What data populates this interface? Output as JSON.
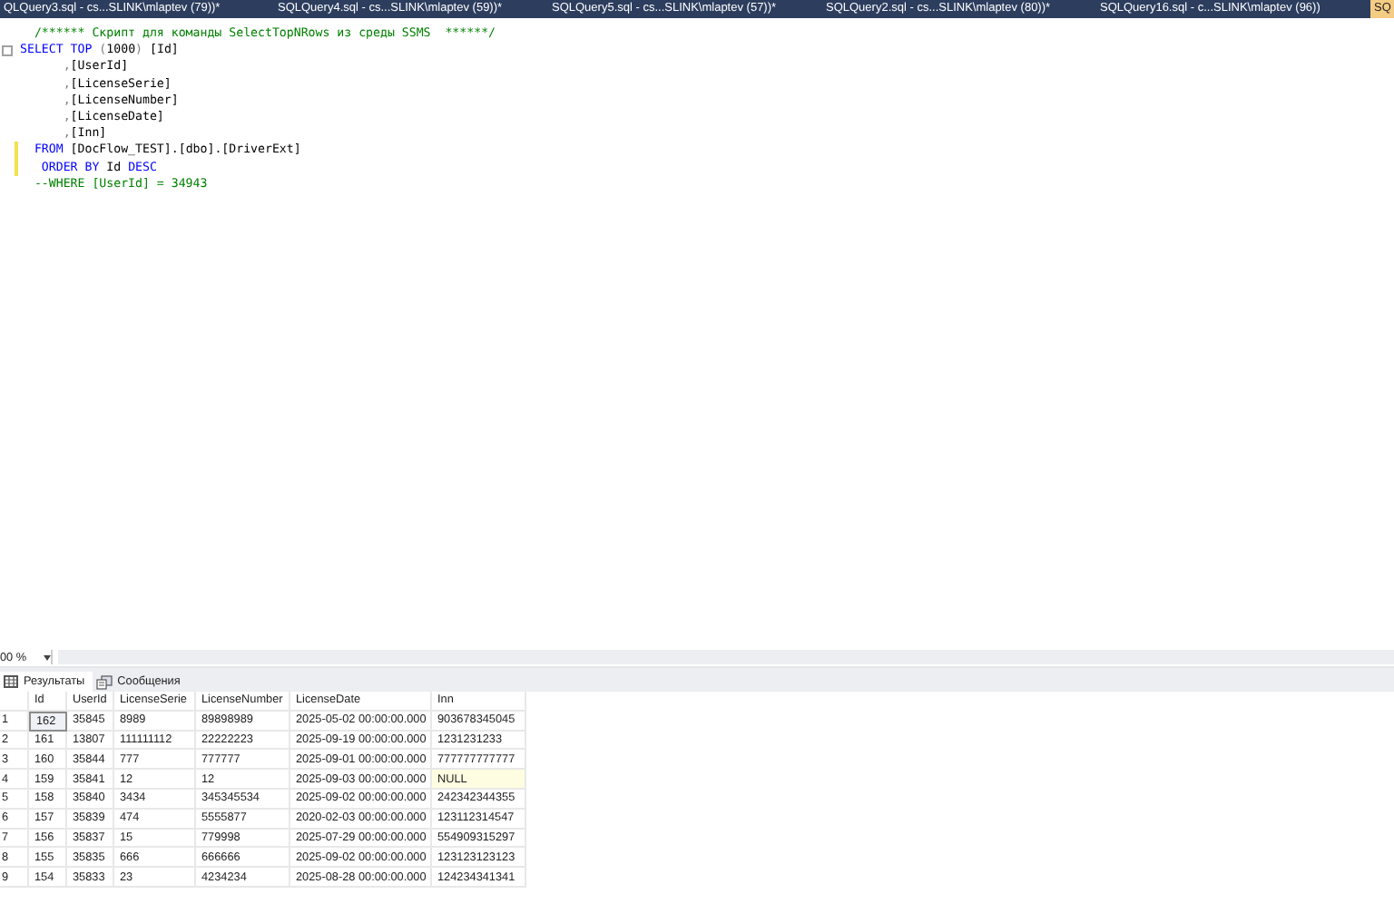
{
  "document_tabs": [
    {
      "label": "QLQuery3.sql - cs...SLINK\\mlaptev (79))*",
      "selected": false
    },
    {
      "label": "SQLQuery4.sql - cs...SLINK\\mlaptev (59))*",
      "selected": false
    },
    {
      "label": "SQLQuery5.sql - cs...SLINK\\mlaptev (57))*",
      "selected": false
    },
    {
      "label": "SQLQuery2.sql - cs...SLINK\\mlaptev (80))*",
      "selected": false
    },
    {
      "label": "SQLQuery16.sql - c...SLINK\\mlaptev (96))",
      "selected": false
    },
    {
      "label": "SQ",
      "selected": true
    }
  ],
  "editor": {
    "lines": [
      {
        "fold": false,
        "changed": false,
        "tokens": [
          {
            "kind": "comment",
            "text": "  /****** Скрипт для команды SelectTopNRows из среды SSMS  ******/"
          }
        ]
      },
      {
        "fold": true,
        "changed": false,
        "tokens": [
          {
            "kind": "keyword",
            "text": "SELECT TOP "
          },
          {
            "kind": "operator",
            "text": "("
          },
          {
            "kind": "plain",
            "text": "1000"
          },
          {
            "kind": "operator",
            "text": ")"
          },
          {
            "kind": "plain",
            "text": " [Id]"
          }
        ]
      },
      {
        "fold": false,
        "changed": false,
        "tokens": [
          {
            "kind": "operator",
            "text": "      ,"
          },
          {
            "kind": "plain",
            "text": "[UserId]"
          }
        ]
      },
      {
        "fold": false,
        "changed": false,
        "tokens": [
          {
            "kind": "operator",
            "text": "      ,"
          },
          {
            "kind": "plain",
            "text": "[LicenseSerie]"
          }
        ]
      },
      {
        "fold": false,
        "changed": false,
        "tokens": [
          {
            "kind": "operator",
            "text": "      ,"
          },
          {
            "kind": "plain",
            "text": "[LicenseNumber]"
          }
        ]
      },
      {
        "fold": false,
        "changed": false,
        "tokens": [
          {
            "kind": "operator",
            "text": "      ,"
          },
          {
            "kind": "plain",
            "text": "[LicenseDate]"
          }
        ]
      },
      {
        "fold": false,
        "changed": false,
        "tokens": [
          {
            "kind": "operator",
            "text": "      ,"
          },
          {
            "kind": "plain",
            "text": "[Inn]"
          }
        ]
      },
      {
        "fold": false,
        "changed": true,
        "tokens": [
          {
            "kind": "keyword",
            "text": "  FROM "
          },
          {
            "kind": "plain",
            "text": "[DocFlow_TEST].[dbo].[DriverExt]"
          }
        ]
      },
      {
        "fold": false,
        "changed": true,
        "tokens": [
          {
            "kind": "keyword",
            "text": "   ORDER BY "
          },
          {
            "kind": "plain",
            "text": "Id "
          },
          {
            "kind": "keyword",
            "text": "DESC"
          }
        ]
      },
      {
        "fold": false,
        "changed": false,
        "tokens": [
          {
            "kind": "comment",
            "text": "  --WHERE [UserId] = 34943"
          }
        ]
      }
    ]
  },
  "zoom": {
    "value": "00 %"
  },
  "result_tabs": [
    {
      "label": "Результаты",
      "kind": "grid",
      "selected": true
    },
    {
      "label": "Сообщения",
      "kind": "messages",
      "selected": false
    }
  ],
  "grid": {
    "columns": [
      "Id",
      "UserId",
      "LicenseSerie",
      "LicenseNumber",
      "LicenseDate",
      "Inn"
    ],
    "rows": [
      {
        "number": "1",
        "cells": [
          {
            "text": "162",
            "kind": "value",
            "selected": true
          },
          {
            "text": "35845",
            "kind": "value",
            "selected": false
          },
          {
            "text": "8989",
            "kind": "value",
            "selected": false
          },
          {
            "text": "89898989",
            "kind": "value",
            "selected": false
          },
          {
            "text": "2025-05-02 00:00:00.000",
            "kind": "value",
            "selected": false
          },
          {
            "text": "903678345045",
            "kind": "value",
            "selected": false
          }
        ]
      },
      {
        "number": "2",
        "cells": [
          {
            "text": "161",
            "kind": "value",
            "selected": false
          },
          {
            "text": "13807",
            "kind": "value",
            "selected": false
          },
          {
            "text": "111111112",
            "kind": "value",
            "selected": false
          },
          {
            "text": "22222223",
            "kind": "value",
            "selected": false
          },
          {
            "text": "2025-09-19 00:00:00.000",
            "kind": "value",
            "selected": false
          },
          {
            "text": "1231231233",
            "kind": "value",
            "selected": false
          }
        ]
      },
      {
        "number": "3",
        "cells": [
          {
            "text": "160",
            "kind": "value",
            "selected": false
          },
          {
            "text": "35844",
            "kind": "value",
            "selected": false
          },
          {
            "text": "777",
            "kind": "value",
            "selected": false
          },
          {
            "text": "777777",
            "kind": "value",
            "selected": false
          },
          {
            "text": "2025-09-01 00:00:00.000",
            "kind": "value",
            "selected": false
          },
          {
            "text": "777777777777",
            "kind": "value",
            "selected": false
          }
        ]
      },
      {
        "number": "4",
        "cells": [
          {
            "text": "159",
            "kind": "value",
            "selected": false
          },
          {
            "text": "35841",
            "kind": "value",
            "selected": false
          },
          {
            "text": "12",
            "kind": "value",
            "selected": false
          },
          {
            "text": "12",
            "kind": "value",
            "selected": false
          },
          {
            "text": "2025-09-03 00:00:00.000",
            "kind": "value",
            "selected": false
          },
          {
            "text": "NULL",
            "kind": "null",
            "selected": false
          }
        ]
      },
      {
        "number": "5",
        "cells": [
          {
            "text": "158",
            "kind": "value",
            "selected": false
          },
          {
            "text": "35840",
            "kind": "value",
            "selected": false
          },
          {
            "text": "3434",
            "kind": "value",
            "selected": false
          },
          {
            "text": "345345534",
            "kind": "value",
            "selected": false
          },
          {
            "text": "2025-09-02 00:00:00.000",
            "kind": "value",
            "selected": false
          },
          {
            "text": "242342344355",
            "kind": "value",
            "selected": false
          }
        ]
      },
      {
        "number": "6",
        "cells": [
          {
            "text": "157",
            "kind": "value",
            "selected": false
          },
          {
            "text": "35839",
            "kind": "value",
            "selected": false
          },
          {
            "text": "474",
            "kind": "value",
            "selected": false
          },
          {
            "text": "5555877",
            "kind": "value",
            "selected": false
          },
          {
            "text": "2020-02-03 00:00:00.000",
            "kind": "value",
            "selected": false
          },
          {
            "text": "123112314547",
            "kind": "value",
            "selected": false
          }
        ]
      },
      {
        "number": "7",
        "cells": [
          {
            "text": "156",
            "kind": "value",
            "selected": false
          },
          {
            "text": "35837",
            "kind": "value",
            "selected": false
          },
          {
            "text": "15",
            "kind": "value",
            "selected": false
          },
          {
            "text": "779998",
            "kind": "value",
            "selected": false
          },
          {
            "text": "2025-07-29 00:00:00.000",
            "kind": "value",
            "selected": false
          },
          {
            "text": "554909315297",
            "kind": "value",
            "selected": false
          }
        ]
      },
      {
        "number": "8",
        "cells": [
          {
            "text": "155",
            "kind": "value",
            "selected": false
          },
          {
            "text": "35835",
            "kind": "value",
            "selected": false
          },
          {
            "text": "666",
            "kind": "value",
            "selected": false
          },
          {
            "text": "666666",
            "kind": "value",
            "selected": false
          },
          {
            "text": "2025-09-02 00:00:00.000",
            "kind": "value",
            "selected": false
          },
          {
            "text": "123123123123",
            "kind": "value",
            "selected": false
          }
        ]
      },
      {
        "number": "9",
        "cells": [
          {
            "text": "154",
            "kind": "value",
            "selected": false
          },
          {
            "text": "35833",
            "kind": "value",
            "selected": false
          },
          {
            "text": "23",
            "kind": "value",
            "selected": false
          },
          {
            "text": "4234234",
            "kind": "value",
            "selected": false
          },
          {
            "text": "2025-08-28 00:00:00.000",
            "kind": "value",
            "selected": false
          },
          {
            "text": "124234341341",
            "kind": "value",
            "selected": false
          }
        ]
      }
    ]
  }
}
